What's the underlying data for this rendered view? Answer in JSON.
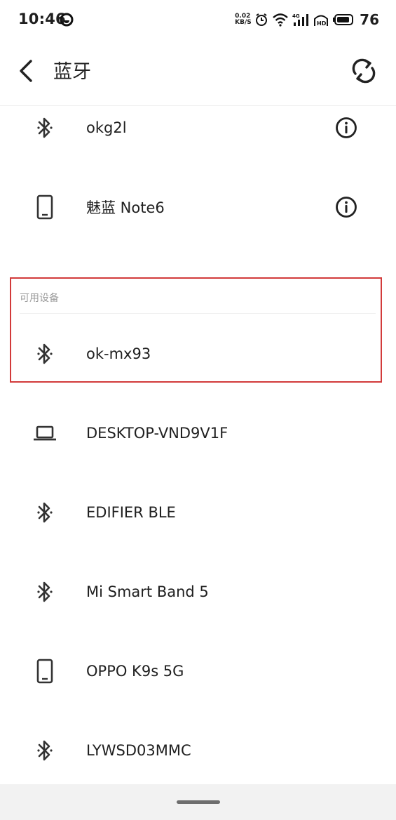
{
  "status_bar": {
    "time": "10:46",
    "net_speed_top": "0.02",
    "net_speed_bottom": "KB/S",
    "battery": "76",
    "icons": [
      "dnd-icon",
      "alarm-icon",
      "wifi-icon",
      "signal-4g-icon",
      "hd-icon",
      "battery-icon"
    ]
  },
  "header": {
    "title": "蓝牙",
    "back_icon": "chevron-left-icon",
    "refresh_icon": "refresh-icon"
  },
  "paired_devices": [
    {
      "name": "okg2l",
      "icon": "bluetooth-icon",
      "has_info": true
    },
    {
      "name": "魅蓝 Note6",
      "icon": "phone-icon",
      "has_info": true
    }
  ],
  "available_section": {
    "label": "可用设备"
  },
  "available_devices": [
    {
      "name": "ok-mx93",
      "icon": "bluetooth-icon"
    },
    {
      "name": "DESKTOP-VND9V1F",
      "icon": "laptop-icon"
    },
    {
      "name": "EDIFIER BLE",
      "icon": "bluetooth-icon"
    },
    {
      "name": "Mi Smart Band 5",
      "icon": "bluetooth-icon"
    },
    {
      "name": "OPPO K9s 5G",
      "icon": "phone-icon"
    },
    {
      "name": "LYWSD03MMC",
      "icon": "bluetooth-icon"
    }
  ],
  "colors": {
    "highlight_border": "#d23a3a",
    "icon": "#333333",
    "section_label": "#9a9a9a"
  }
}
